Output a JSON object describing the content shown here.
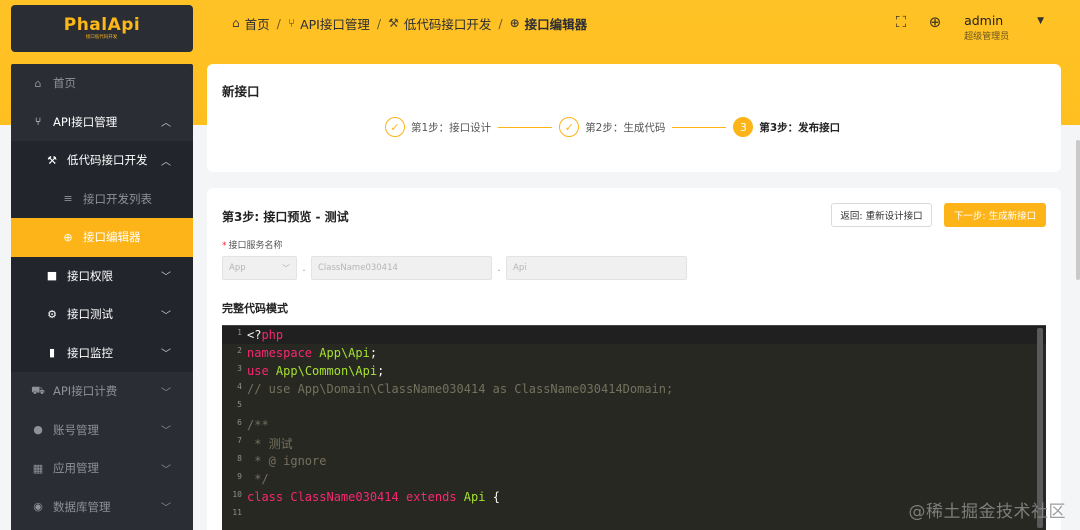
{
  "app": {
    "logo_text": "PhalApi",
    "logo_sub": "接口低代码开发"
  },
  "breadcrumb": [
    {
      "label": "首页",
      "icon": "home-icon"
    },
    {
      "label": "API接口管理",
      "icon": "api-branch-icon"
    },
    {
      "label": "低代码接口开发",
      "icon": "tool-icon"
    },
    {
      "label": "接口编辑器",
      "icon": "plus-circle-icon"
    }
  ],
  "header": {
    "user_name": "admin",
    "user_role": "超级管理员"
  },
  "sidebar": {
    "items": [
      {
        "label": "首页",
        "icon": "home-icon"
      },
      {
        "label": "API接口管理",
        "icon": "api-branch-icon"
      },
      {
        "label": "低代码接口开发",
        "icon": "tool-icon"
      },
      {
        "label": "接口开发列表",
        "icon": "list-icon"
      },
      {
        "label": "接口编辑器",
        "icon": "plus-circle-icon"
      },
      {
        "label": "接口权限",
        "icon": "lock-icon"
      },
      {
        "label": "接口测试",
        "icon": "gear-icon"
      },
      {
        "label": "接口监控",
        "icon": "bar-chart-icon"
      },
      {
        "label": "API接口计费",
        "icon": "cart-icon"
      },
      {
        "label": "账号管理",
        "icon": "user-icon"
      },
      {
        "label": "应用管理",
        "icon": "grid-icon"
      },
      {
        "label": "数据库管理",
        "icon": "database-icon"
      }
    ]
  },
  "wizard": {
    "title": "新接口",
    "steps": [
      {
        "number": "1",
        "label": "第1步：接口设计",
        "status": "done"
      },
      {
        "number": "2",
        "label": "第2步：生成代码",
        "status": "done"
      },
      {
        "number": "3",
        "label": "第3步：发布接口",
        "status": "current"
      }
    ]
  },
  "step3": {
    "title": "第3步: 接口预览 - 测试",
    "back_button": "返回: 重新设计接口",
    "next_button": "下一步: 生成新接口",
    "service_label": "接口服务名称",
    "service_app_value": "App",
    "service_class_value": "ClassName030414",
    "service_api_value": "Api",
    "separator": ".",
    "code_mode_label": "完整代码模式"
  },
  "code_lines": [
    "<?php",
    "namespace App\\Api;",
    "use App\\Common\\Api;",
    "// use App\\Domain\\ClassName030414 as ClassName030414Domain;",
    "",
    "/**",
    " * 测试",
    " * @ ignore",
    " */",
    "class ClassName030414 extends Api {",
    ""
  ],
  "watermark": "@稀土掘金技术社区",
  "colors": {
    "accent": "#fdb418",
    "sidebar_bg": "#2b2d35",
    "editor_bg": "#272822"
  }
}
